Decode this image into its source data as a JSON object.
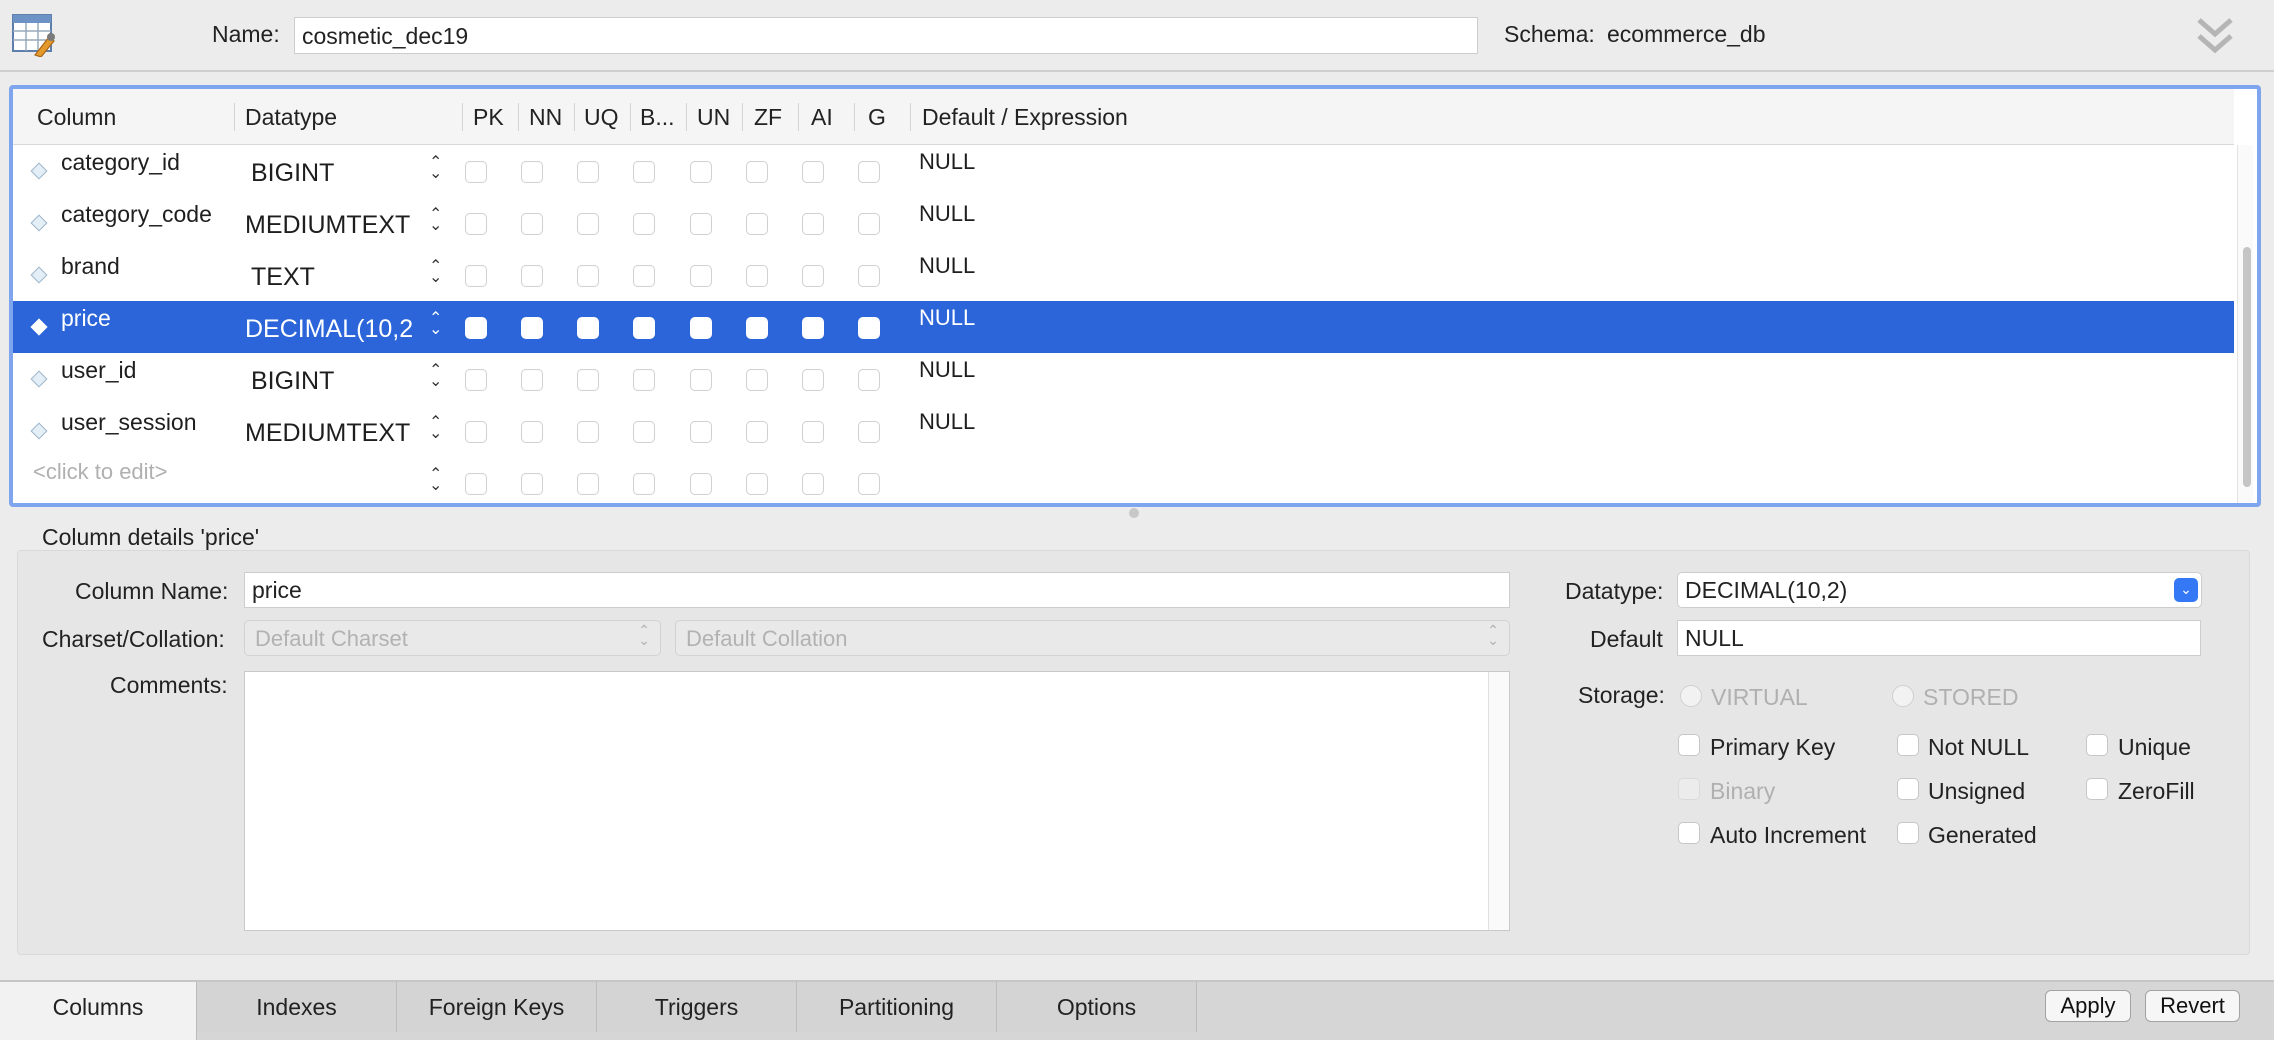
{
  "header": {
    "name_label": "Name:",
    "name_value": "cosmetic_dec19",
    "schema_label": "Schema:",
    "schema_value": "ecommerce_db"
  },
  "grid": {
    "headers": [
      "Column",
      "Datatype",
      "PK",
      "NN",
      "UQ",
      "B...",
      "UN",
      "ZF",
      "AI",
      "G",
      "Default / Expression"
    ],
    "rows": [
      {
        "name": "category_id",
        "type": "BIGINT",
        "default": "NULL"
      },
      {
        "name": "category_code",
        "type": "MEDIUMTEXT",
        "default": "NULL"
      },
      {
        "name": "brand",
        "type": "TEXT",
        "default": "NULL"
      },
      {
        "name": "price",
        "type": "DECIMAL(10,2",
        "default": "NULL"
      },
      {
        "name": "user_id",
        "type": "BIGINT",
        "default": "NULL"
      },
      {
        "name": "user_session",
        "type": "MEDIUMTEXT",
        "default": "NULL"
      }
    ],
    "placeholder": "<click to edit>",
    "selected_row": "price"
  },
  "details": {
    "title": "Column details 'price'",
    "column_name_label": "Column Name:",
    "column_name_value": "price",
    "charset_label": "Charset/Collation:",
    "charset_value": "Default Charset",
    "collation_value": "Default Collation",
    "comments_label": "Comments:",
    "comments_value": "",
    "datatype_label": "Datatype:",
    "datatype_value": "DECIMAL(10,2)",
    "default_label": "Default",
    "default_value": "NULL",
    "storage_label": "Storage:",
    "virtual_label": "VIRTUAL",
    "stored_label": "STORED",
    "flags": {
      "primary_key": "Primary Key",
      "not_null": "Not NULL",
      "unique": "Unique",
      "binary": "Binary",
      "unsigned": "Unsigned",
      "zerofill": "ZeroFill",
      "auto_increment": "Auto Increment",
      "generated": "Generated"
    }
  },
  "tabs": [
    "Columns",
    "Indexes",
    "Foreign Keys",
    "Triggers",
    "Partitioning",
    "Options"
  ],
  "active_tab": "Columns",
  "buttons": {
    "apply": "Apply",
    "revert": "Revert"
  },
  "icons": {
    "app": "table-editor-icon",
    "collapse": "double-chevron-down-icon",
    "row": "diamond-column-icon",
    "spinner": "updown-spinner-icon"
  },
  "colors": {
    "selection": "#2b65d9",
    "focus_ring": "#7ea5ee",
    "accent": "#3478f6"
  }
}
